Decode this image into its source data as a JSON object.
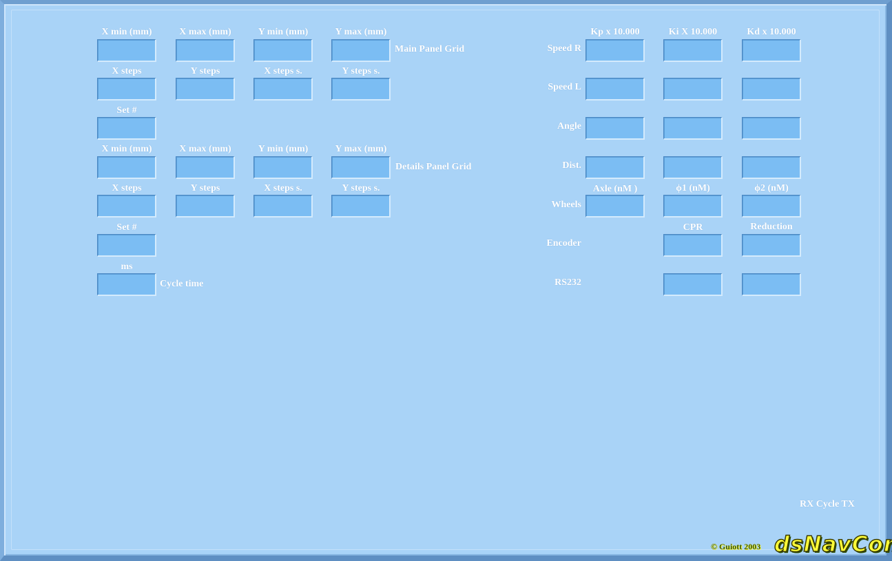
{
  "main_grid": {
    "section_label": "Main Panel Grid",
    "row1_headers": [
      "X min (mm)",
      "X max (mm)",
      "Y min (mm)",
      "Y max (mm)"
    ],
    "row2_headers": [
      "X steps",
      "Y steps",
      "X steps s.",
      "Y steps s."
    ],
    "set_label": "Set #"
  },
  "details_grid": {
    "section_label": "Details Panel Grid",
    "row1_headers": [
      "X min (mm)",
      "X max (mm)",
      "Y min (mm)",
      "Y max (mm)"
    ],
    "row2_headers": [
      "X steps",
      "Y steps",
      "X steps s.",
      "Y steps s."
    ],
    "set_label": "Set #"
  },
  "cycle": {
    "unit": "ms",
    "label": "Cycle time"
  },
  "pid": {
    "headers": [
      "Kp x 10.000",
      "Ki X 10.000",
      "Kd x 10.000"
    ],
    "rows": [
      "Speed R",
      "Speed L",
      "Angle",
      "Dist."
    ]
  },
  "wheels": {
    "label": "Wheels",
    "headers": [
      "Axle (nM )",
      "ϕ1 (nM)",
      "ϕ2 (nM)"
    ]
  },
  "encoder": {
    "label": "Encoder",
    "headers": [
      "CPR",
      "Reduction"
    ]
  },
  "rs232": {
    "label": "RS232"
  },
  "status": {
    "rx": "RX",
    "cycle": "Cycle",
    "tx": "TX"
  },
  "footer": {
    "copyright": "© Guiott 2003",
    "logo": "dsNavCon"
  },
  "colors": {
    "background": "#a9d3f7",
    "field": "#7bbdf3",
    "logo": "#ffff38"
  }
}
